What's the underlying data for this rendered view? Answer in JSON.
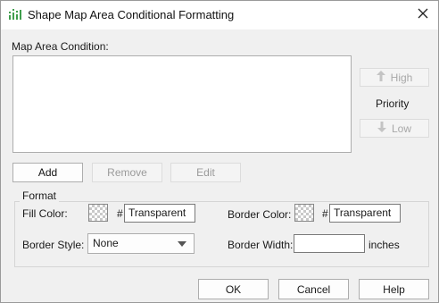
{
  "window": {
    "title": "Shape Map Area Conditional Formatting",
    "app_icon": "report-bars-icon",
    "close_icon": "close-icon"
  },
  "condition": {
    "label": "Map Area Condition:",
    "items": []
  },
  "priority": {
    "label": "Priority",
    "high_label": "High",
    "low_label": "Low"
  },
  "actions": {
    "add": "Add",
    "remove": "Remove",
    "edit": "Edit"
  },
  "format": {
    "group_title": "Format",
    "fill_color_label": "Fill Color:",
    "fill_hash": "#",
    "fill_value": "Transparent",
    "border_color_label": "Border Color:",
    "border_hash": "#",
    "border_value": "Transparent",
    "border_style_label": "Border Style:",
    "border_style_value": "None",
    "border_width_label": "Border Width:",
    "border_width_value": "",
    "border_width_unit": "inches"
  },
  "footer": {
    "ok": "OK",
    "cancel": "Cancel",
    "help": "Help"
  },
  "colors": {
    "accent_icon": "#3f9e4d",
    "disabled_text": "#a8a8a8"
  }
}
